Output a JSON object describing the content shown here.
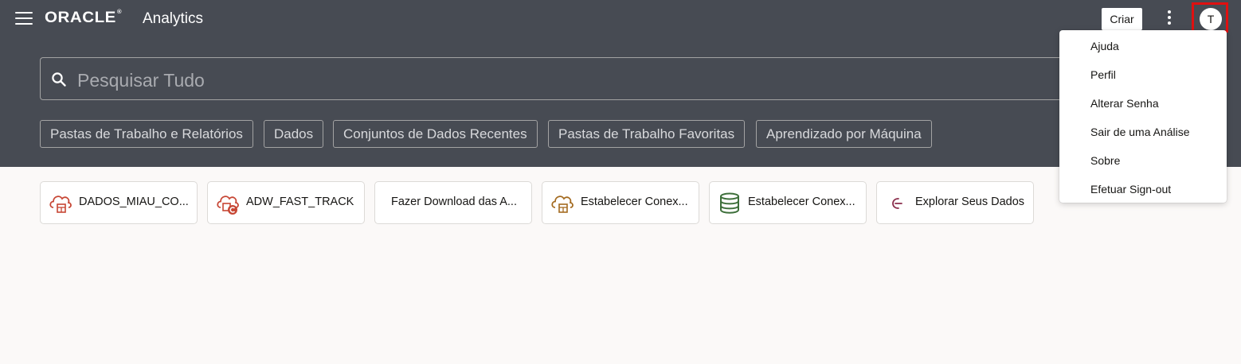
{
  "header": {
    "logo_text": "ORACLE",
    "logo_reg": "®",
    "app_title": "Analytics",
    "create_label": "Criar",
    "avatar_initial": "T"
  },
  "search": {
    "placeholder": "Pesquisar Tudo",
    "value": ""
  },
  "filters": [
    "Pastas de Trabalho e Relatórios",
    "Dados",
    "Conjuntos de Dados Recentes",
    "Pastas de Trabalho Favoritas",
    "Aprendizado por Máquina"
  ],
  "cards": [
    {
      "label": "DADOS_MIAU_CO...",
      "icon": "cloud-database-icon"
    },
    {
      "label": "ADW_FAST_TRACK",
      "icon": "cloud-database-connection-icon"
    },
    {
      "label": "Fazer Download das A...",
      "icon": ""
    },
    {
      "label": "Estabelecer Conex...",
      "icon": "cloud-connection-icon"
    },
    {
      "label": "Estabelecer Conex...",
      "icon": "database-icon"
    },
    {
      "label": "Explorar Seus Dados",
      "icon": "explore-icon"
    }
  ],
  "user_menu": {
    "items": [
      "Ajuda",
      "Perfil",
      "Alterar Senha",
      "Sair de uma Análise",
      "Sobre",
      "Efetuar Sign-out"
    ]
  },
  "colors": {
    "header_bg": "#474b53",
    "page_bg": "#fbf9f8",
    "highlight_frame": "#e01010",
    "cloud_red": "#c74634",
    "cloud_orange": "#a36a1f",
    "database_green": "#3d6f3a",
    "explore_accent": "#8a2d4b"
  }
}
